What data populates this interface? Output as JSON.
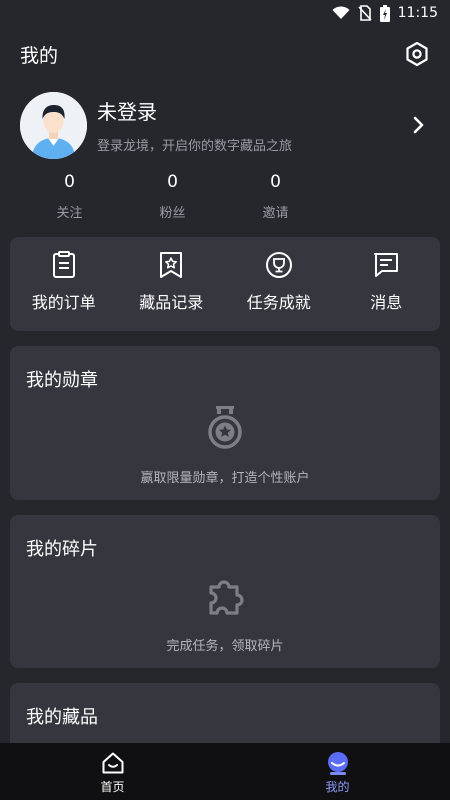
{
  "status_bar": {
    "time": "11:15"
  },
  "header": {
    "title": "我的"
  },
  "profile": {
    "name": "未登录",
    "subtitle": "登录龙境，开启你的数字藏品之旅"
  },
  "stats": [
    {
      "value": "0",
      "label": "关注"
    },
    {
      "value": "0",
      "label": "粉丝"
    },
    {
      "value": "0",
      "label": "邀请"
    }
  ],
  "quick_actions": [
    {
      "label": "我的订单",
      "icon": "clipboard-icon"
    },
    {
      "label": "藏品记录",
      "icon": "bookmark-star-icon"
    },
    {
      "label": "任务成就",
      "icon": "trophy-icon"
    },
    {
      "label": "消息",
      "icon": "message-icon"
    }
  ],
  "sections": {
    "medals": {
      "title": "我的勋章",
      "hint": "赢取限量勋章，打造个性账户"
    },
    "fragments": {
      "title": "我的碎片",
      "hint": "完成任务，领取碎片"
    },
    "collections": {
      "title": "我的藏品"
    }
  },
  "tabbar": [
    {
      "label": "首页",
      "icon": "home-icon",
      "active": false
    },
    {
      "label": "我的",
      "icon": "profile-tab-icon",
      "active": true
    }
  ],
  "colors": {
    "background": "#26272d",
    "card": "#35363e",
    "tabbar": "#101012",
    "accent": "#5b6cf5",
    "muted_text": "#9a9ba3"
  }
}
